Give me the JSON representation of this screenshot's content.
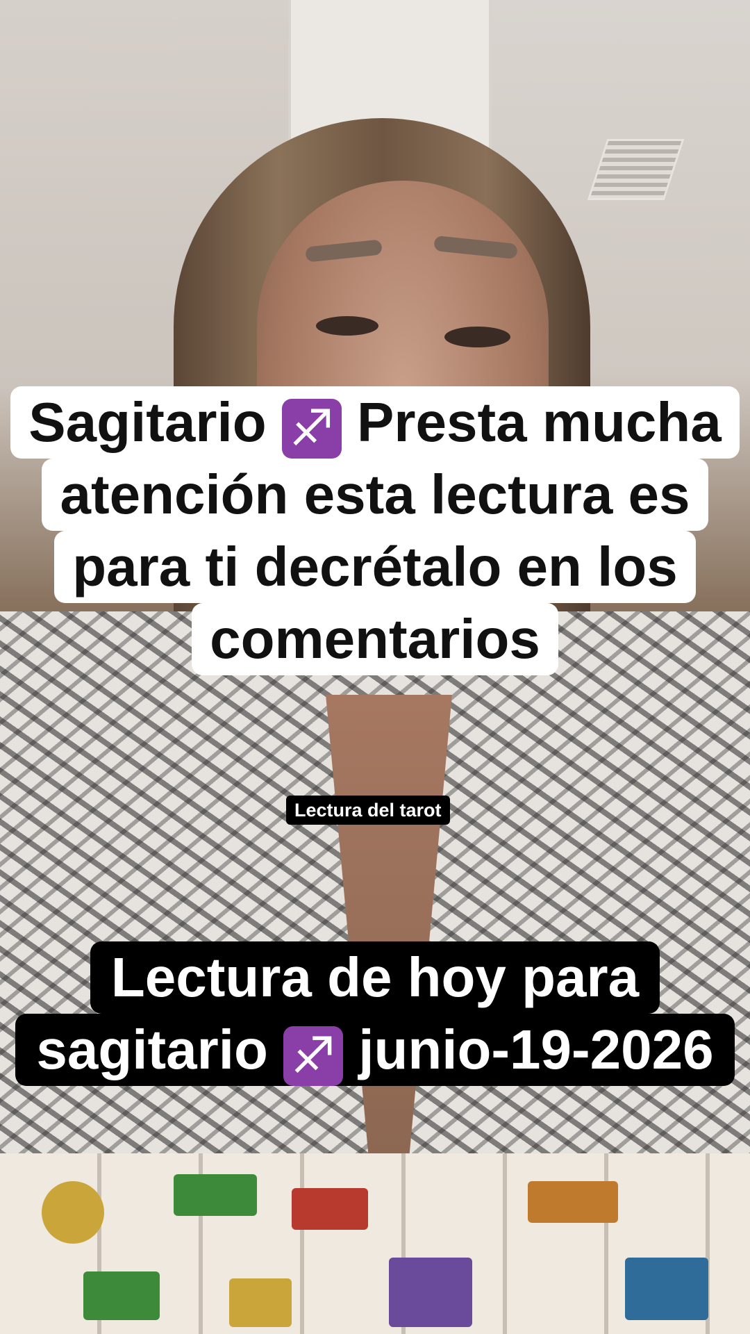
{
  "caption_top": {
    "line1_before": "Sagitario",
    "line1_after": "Presta mucha",
    "line2": "atención esta lectura es",
    "line3": "para ti decrétalo en los",
    "line4": "comentarios",
    "icon": "sagittarius-icon"
  },
  "tag_label": "Lectura del tarot",
  "caption_bottom": {
    "line1": "Lectura de hoy para",
    "line2_before": "sagitario",
    "line2_after": "junio-19-2026",
    "icon": "sagittarius-icon"
  },
  "zodiac_glyph": "♐",
  "colors": {
    "top_caption_bg": "#ffffff",
    "bottom_caption_bg": "#000000",
    "zodiac_icon_bg": "#8a3ea8"
  }
}
